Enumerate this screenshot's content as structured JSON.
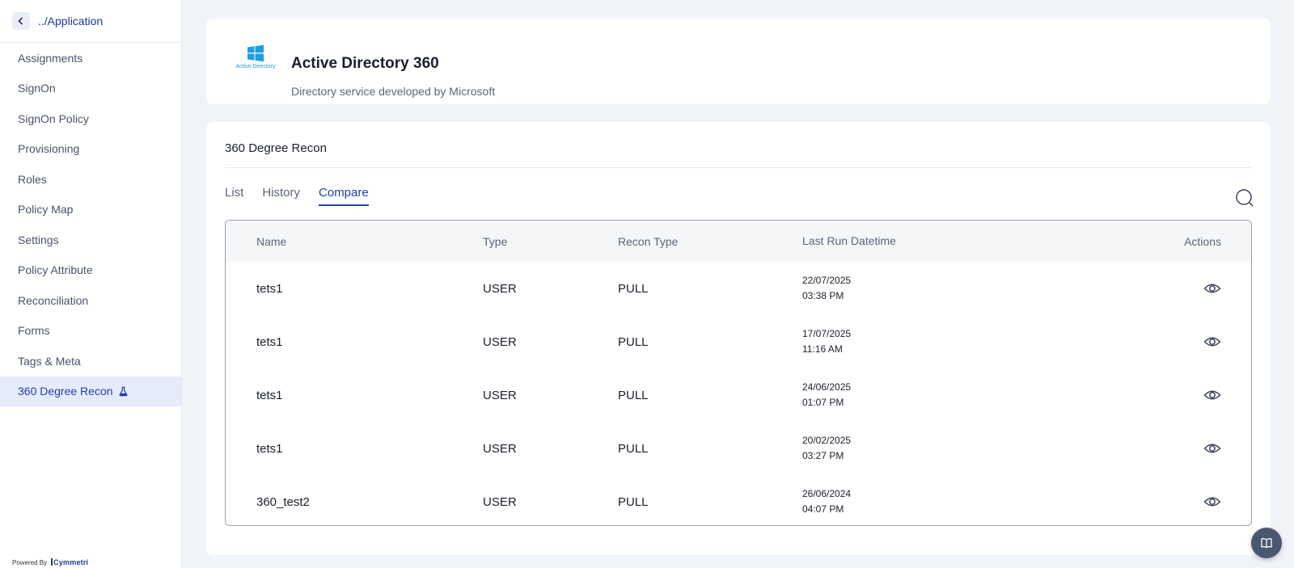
{
  "breadcrumb": {
    "label": "../Application"
  },
  "sidebar": {
    "items": [
      {
        "label": "Assignments"
      },
      {
        "label": "SignOn"
      },
      {
        "label": "SignOn Policy"
      },
      {
        "label": "Provisioning"
      },
      {
        "label": "Roles"
      },
      {
        "label": "Policy Map"
      },
      {
        "label": "Settings"
      },
      {
        "label": "Policy Attribute"
      },
      {
        "label": "Reconciliation"
      },
      {
        "label": "Forms"
      },
      {
        "label": "Tags & Meta"
      },
      {
        "label": "360 Degree Recon",
        "active": true
      }
    ]
  },
  "footer": {
    "powered_by": "Powered By",
    "brand": "Cymmetri"
  },
  "app": {
    "logo_text": "Active Directory",
    "title": "Active Directory 360",
    "subtitle": "Directory service developed by Microsoft"
  },
  "recon": {
    "title": "360 Degree Recon",
    "tabs": [
      {
        "label": "List"
      },
      {
        "label": "History"
      },
      {
        "label": "Compare",
        "active": true
      }
    ],
    "columns": {
      "name": "Name",
      "type": "Type",
      "recon_type": "Recon Type",
      "last_run": "Last Run Datetime",
      "actions": "Actions"
    },
    "rows": [
      {
        "name": "tets1",
        "type": "USER",
        "recon_type": "PULL",
        "date": "22/07/2025",
        "time": "03:38 PM"
      },
      {
        "name": "tets1",
        "type": "USER",
        "recon_type": "PULL",
        "date": "17/07/2025",
        "time": "11:16 AM"
      },
      {
        "name": "tets1",
        "type": "USER",
        "recon_type": "PULL",
        "date": "24/06/2025",
        "time": "01:07 PM"
      },
      {
        "name": "tets1",
        "type": "USER",
        "recon_type": "PULL",
        "date": "20/02/2025",
        "time": "03:27 PM"
      },
      {
        "name": "360_test2",
        "type": "USER",
        "recon_type": "PULL",
        "date": "26/06/2024",
        "time": "04:07 PM"
      }
    ]
  },
  "colors": {
    "accent": "#1e40af",
    "active_bg": "#e6ebfb",
    "windows_blue": "#1a9ee0"
  },
  "icons": {
    "back": "chevron-left-icon",
    "flask": "flask-icon",
    "search": "search-icon",
    "view": "eye-icon",
    "help": "book-icon"
  }
}
